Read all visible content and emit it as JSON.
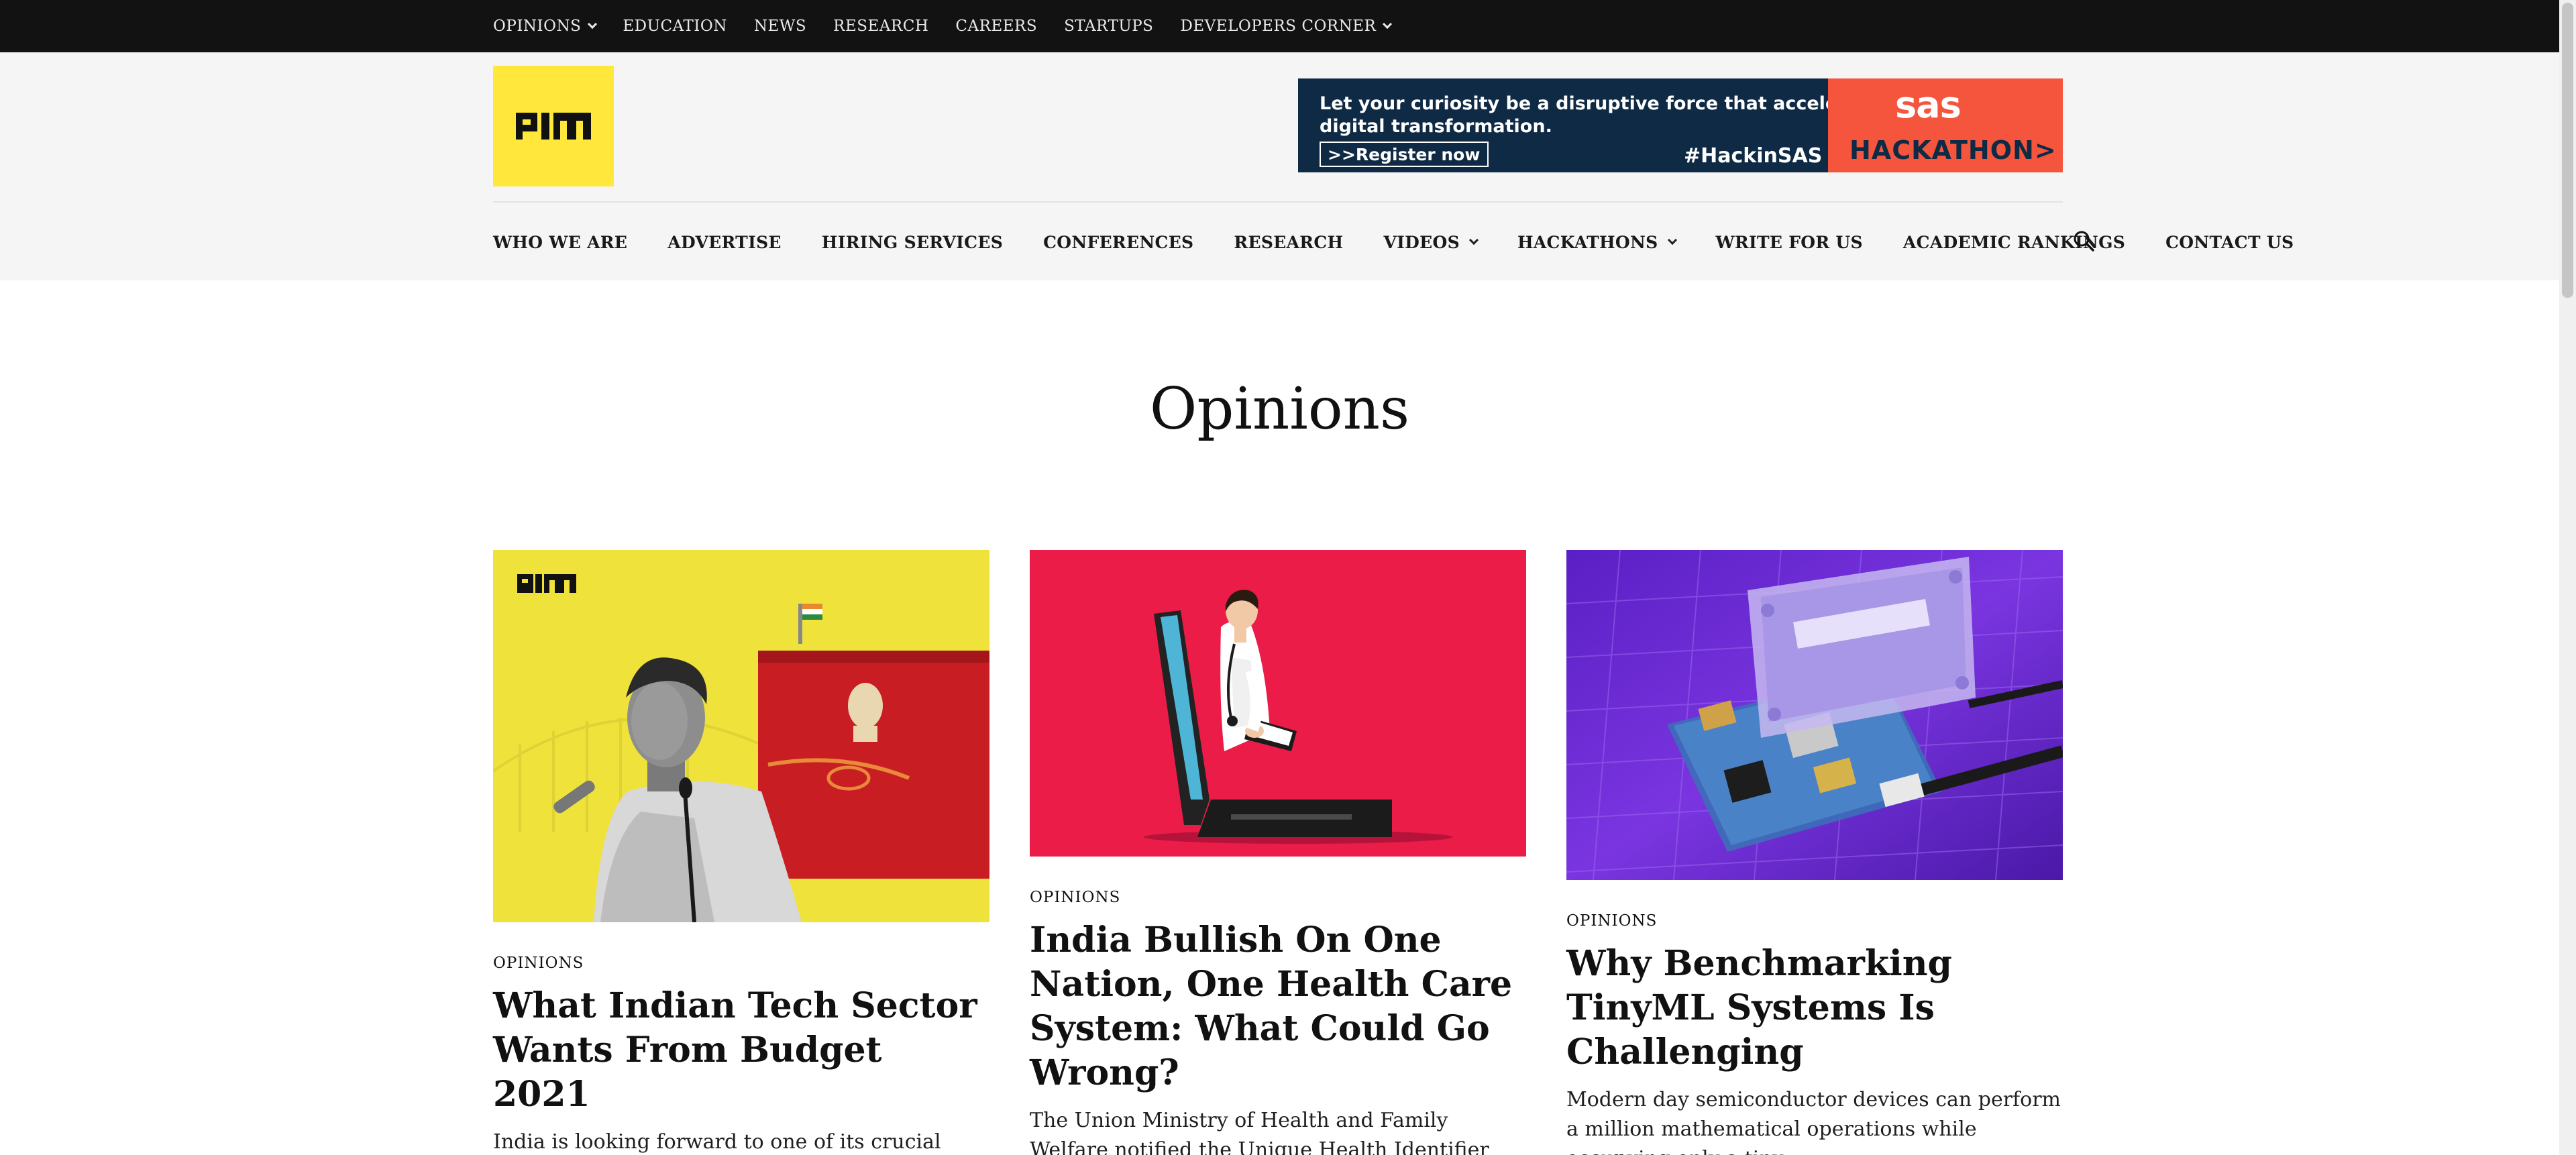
{
  "top_nav": {
    "items": [
      {
        "label": "OPINIONS",
        "has_dropdown": true
      },
      {
        "label": "EDUCATION",
        "has_dropdown": false
      },
      {
        "label": "NEWS",
        "has_dropdown": false
      },
      {
        "label": "RESEARCH",
        "has_dropdown": false
      },
      {
        "label": "CAREERS",
        "has_dropdown": false
      },
      {
        "label": "STARTUPS",
        "has_dropdown": false
      },
      {
        "label": "DEVELOPERS CORNER",
        "has_dropdown": true
      }
    ]
  },
  "logo": {
    "text": "AIM",
    "color": "#ffe83b"
  },
  "ad": {
    "line1": "Let your curiosity be a disruptive force that accelerates",
    "line2": "digital transformation.",
    "button": ">>Register now",
    "hashtag": "#HackinSAS",
    "brand": "sas",
    "event": "HACKATHON>"
  },
  "main_nav": {
    "items": [
      {
        "label": "WHO WE ARE",
        "has_dropdown": false
      },
      {
        "label": "ADVERTISE",
        "has_dropdown": false
      },
      {
        "label": "HIRING SERVICES",
        "has_dropdown": false
      },
      {
        "label": "CONFERENCES",
        "has_dropdown": false
      },
      {
        "label": "RESEARCH",
        "has_dropdown": false
      },
      {
        "label": "VIDEOS",
        "has_dropdown": true
      },
      {
        "label": "HACKATHONS",
        "has_dropdown": true
      },
      {
        "label": "WRITE FOR US",
        "has_dropdown": false
      },
      {
        "label": "ACADEMIC RANKINGS",
        "has_dropdown": false
      },
      {
        "label": "CONTACT US",
        "has_dropdown": false
      }
    ],
    "search_icon": "search-icon"
  },
  "page": {
    "title": "Opinions"
  },
  "articles": [
    {
      "category": "OPINIONS",
      "title": "What Indian Tech Sector Wants From Budget 2021",
      "excerpt": "India is looking forward to one of its crucial budgets since independence as the country’s...",
      "image_desc": "budget-photo"
    },
    {
      "category": "OPINIONS",
      "title": "India Bullish On One Nation, One Health Care System: What Could Go Wrong?",
      "excerpt": "The Union Ministry of Health and Family Welfare notified the Unique Health Identifier (UHID) Rules,...",
      "image_desc": "doctor-illustration"
    },
    {
      "category": "OPINIONS",
      "title": "Why Benchmarking TinyML Systems Is Challenging",
      "excerpt": "Modern day semiconductor devices can perform a million mathematical operations while occupying only a tiny...",
      "image_desc": "circuit-board-photo"
    }
  ],
  "colors": {
    "topbar": "#121212",
    "header_bg": "#f5f5f5",
    "accent_yellow": "#ffe83b",
    "card2_bg": "#ec1c48",
    "card3_bg": "#6a2bd6"
  }
}
